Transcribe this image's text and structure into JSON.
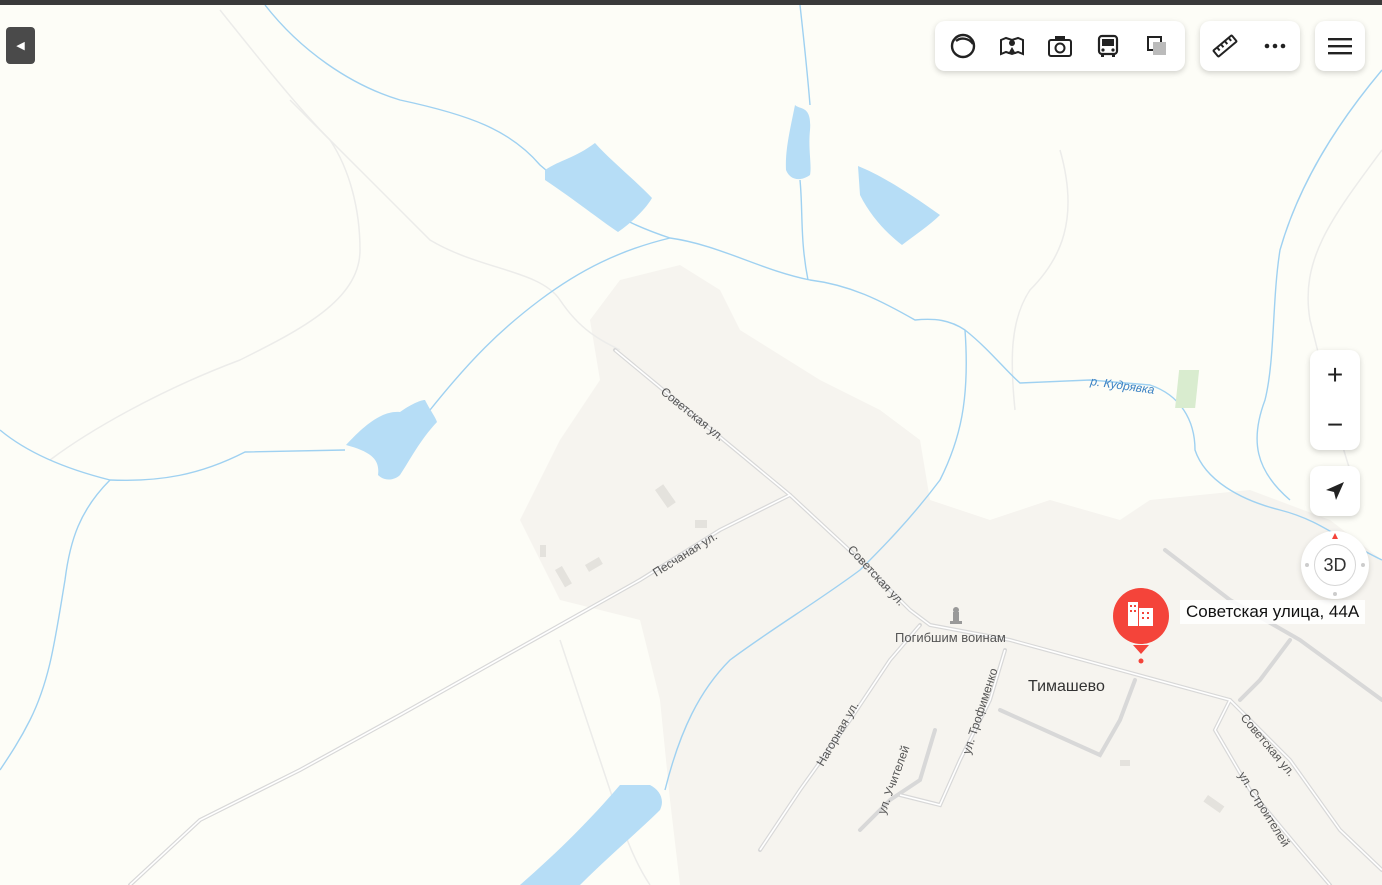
{
  "map": {
    "streets": {
      "sovetskaya_1": "Советская ул.",
      "sovetskaya_2": "Советская ул.",
      "sovetskaya_3": "Советская ул.",
      "peschanaya": "Песчаная ул.",
      "nagornaya": "Нагорная ул.",
      "uchiteley": "ул. Учителей",
      "trofimenko": "ул. Трофименко",
      "stroiteley": "ул. Строителей"
    },
    "river_label": "р. Кудрявка",
    "village_label": "Тимашево",
    "monument_label": "Погибшим воинам",
    "pin_label": "Советская улица, 44А"
  },
  "toolbar": {
    "icons": [
      "layers-icon",
      "panorama-icon",
      "photo-icon",
      "transport-icon",
      "offline-maps-icon"
    ],
    "tools_icons": [
      "ruler-icon",
      "more-icon"
    ],
    "menu_icon": "hamburger-menu-icon"
  },
  "controls": {
    "zoom_in": "+",
    "zoom_out": "−",
    "compass_label": "3D"
  },
  "colors": {
    "water": "#b4dcf7",
    "river_line": "#9cd0f0",
    "pin": "#f4443a",
    "settlement": "#f5f3ee",
    "road": "#d6d6d6"
  }
}
